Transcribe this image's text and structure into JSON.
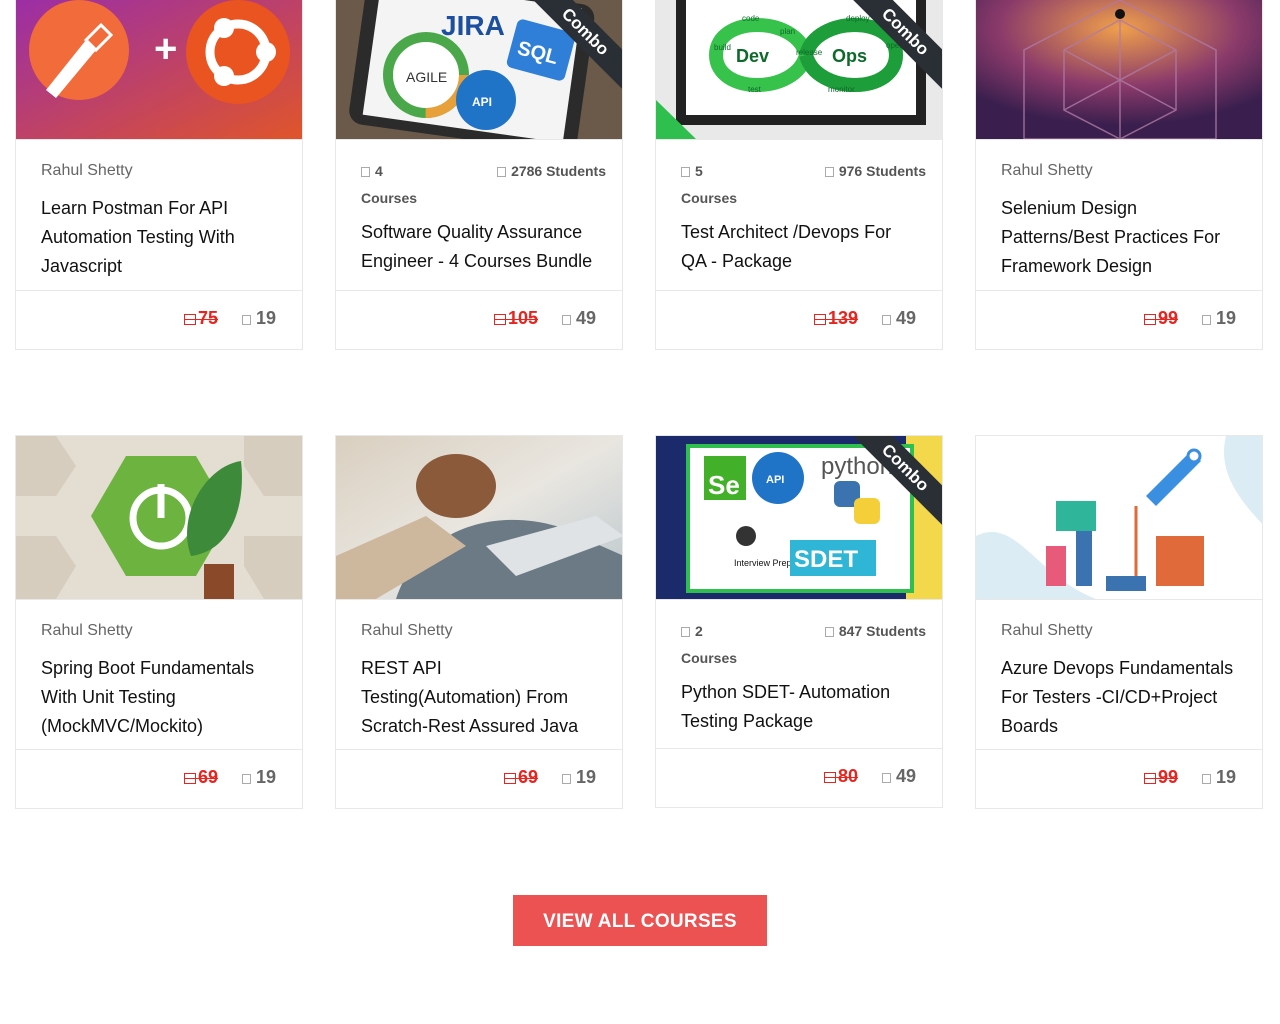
{
  "courses": [
    {
      "author": "Rahul Shetty",
      "title": "Learn Postman For API Automation Testing With Javascript",
      "price": "75",
      "lessons": "19"
    },
    {
      "badge": "Combo",
      "courses_count": "4",
      "courses_word": "Courses",
      "students": "2786 Students",
      "title": "Software Quality Assurance Engineer - 4 Courses Bundle",
      "price": "105",
      "lessons": "49",
      "thumb_texts": [
        "JIRA",
        "AGILE",
        "SQL",
        "API"
      ]
    },
    {
      "badge": "Combo",
      "courses_count": "5",
      "courses_word": "Courses",
      "students": "976 Students",
      "title": "Test Architect /Devops For QA - Package",
      "price": "139",
      "lessons": "49",
      "thumb_texts": [
        "Dev",
        "Ops",
        "code",
        "deploy",
        "build",
        "plan",
        "release",
        "operate",
        "test",
        "monitor"
      ]
    },
    {
      "author": "Rahul Shetty",
      "title": "Selenium Design Patterns/Best Practices For Framework Design",
      "price": "99",
      "lessons": "19"
    },
    {
      "author": "Rahul Shetty",
      "title": "Spring Boot Fundamentals With Unit Testing (MockMVC/Mockito)",
      "price": "69",
      "lessons": "19"
    },
    {
      "author": "Rahul Shetty",
      "title": "REST API Testing(Automation) From Scratch-Rest Assured Java",
      "price": "69",
      "lessons": "19"
    },
    {
      "badge": "Combo",
      "courses_count": "2",
      "courses_word": "Courses",
      "students": "847 Students",
      "title": "Python SDET- Automation Testing Package",
      "price": "80",
      "lessons": "49",
      "thumb_texts": [
        "Se",
        "API",
        "python",
        "Interview Preparation",
        "SDET"
      ]
    },
    {
      "author": "Rahul Shetty",
      "title": "Azure Devops Fundamentals For Testers -CI/CD+Project Boards",
      "price": "99",
      "lessons": "19"
    }
  ],
  "view_all_label": "VIEW ALL COURSES",
  "colors": {
    "accent": "#ec5252",
    "price": "#e8241f",
    "ribbon": "#2a2f36"
  }
}
